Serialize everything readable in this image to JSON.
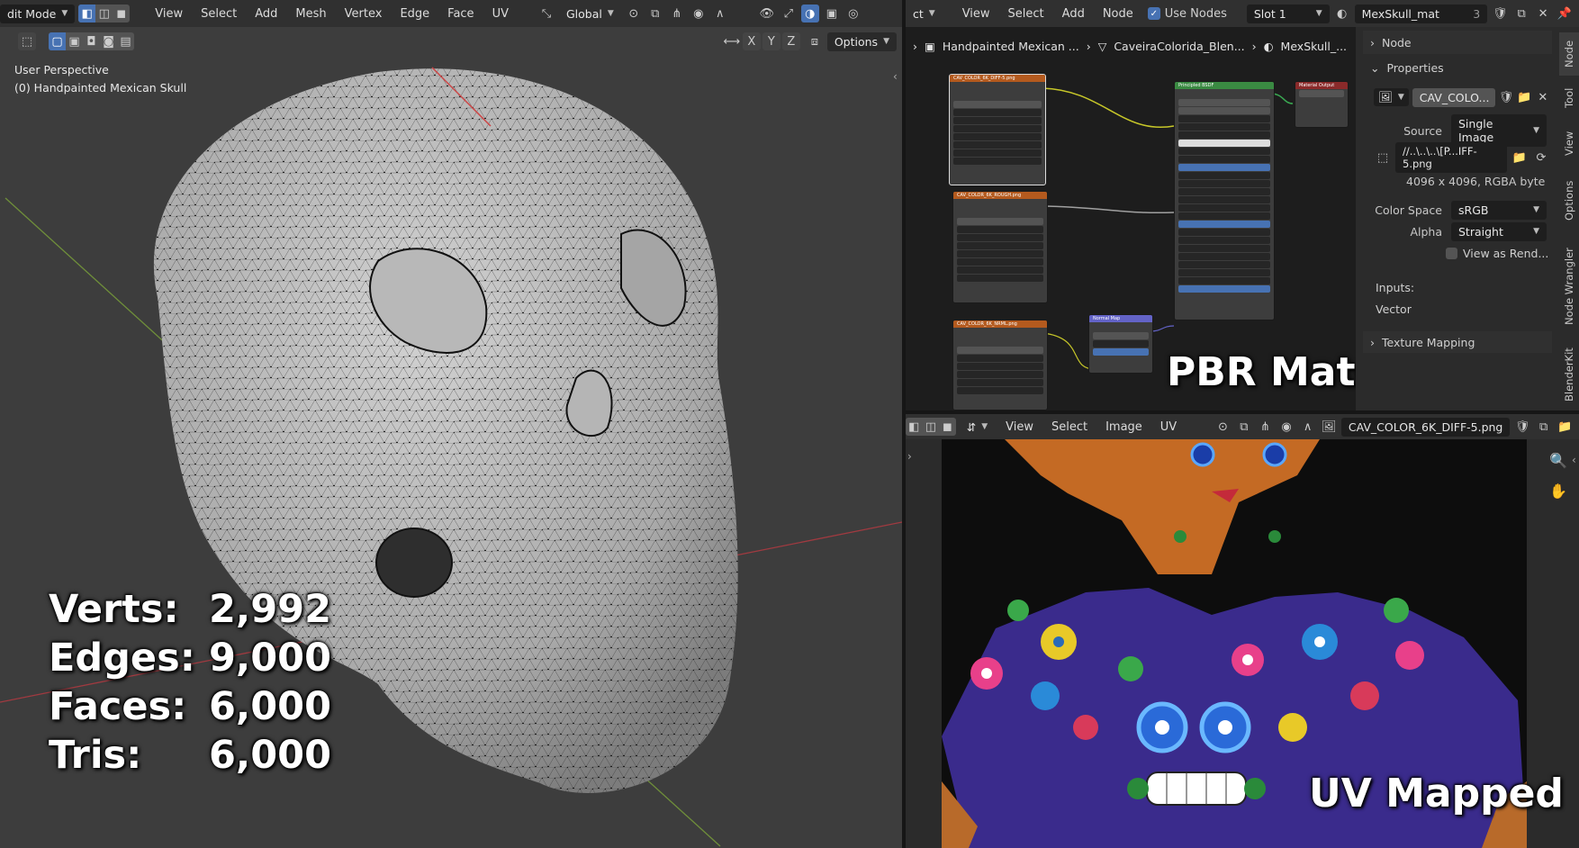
{
  "viewport": {
    "mode": "dit Mode",
    "menus": [
      "View",
      "Select",
      "Add",
      "Mesh",
      "Vertex",
      "Edge",
      "Face",
      "UV"
    ],
    "orientation": "Global",
    "axes": [
      "X",
      "Y",
      "Z"
    ],
    "options": "Options",
    "persp": "User Perspective",
    "object": "(0) Handpainted Mexican Skull",
    "stats": [
      {
        "k": "Verts:",
        "v": "2,992"
      },
      {
        "k": "Edges:",
        "v": "9,000"
      },
      {
        "k": "Faces:",
        "v": "6,000"
      },
      {
        "k": "Tris:",
        "v": "6,000"
      }
    ]
  },
  "node_editor": {
    "type": "ct",
    "menus": [
      "View",
      "Select",
      "Add",
      "Node"
    ],
    "use_nodes": "Use Nodes",
    "slot": "Slot 1",
    "material": "MexSkull_mat",
    "users": "3",
    "breadcrumb": [
      "Handpainted Mexican ...",
      "CaveiraColorida_Blen...",
      "MexSkull_..."
    ],
    "overlay": "PBR Material",
    "nodes": {
      "tex1": "CAV_COLOR_6K_DIFF-5.png",
      "tex2": "CAV_COLOR_6K_ROUGH.png",
      "tex3": "CAV_COLOR_6K_NRML.png",
      "bsdf": "Principled BSDF",
      "out": "Material Output",
      "normal": "Normal Map"
    }
  },
  "sidebar": {
    "node_panel": "Node",
    "properties_panel": "Properties",
    "image_name": "CAV_COLO...",
    "source_label": "Source",
    "source_value": "Single Image",
    "filepath": "//..\\..\\..\\[P...IFF-5.png",
    "resolution": "4096 x 4096,  RGBA byte",
    "colorspace_label": "Color Space",
    "colorspace_value": "sRGB",
    "alpha_label": "Alpha",
    "alpha_value": "Straight",
    "view_as_render": "View as Rend...",
    "inputs": "Inputs:",
    "vector": "Vector",
    "texture_mapping": "Texture Mapping",
    "tabs": [
      "Node",
      "Tool",
      "View",
      "Options",
      "Node Wrangler",
      "BlenderKit"
    ]
  },
  "uv_editor": {
    "menus": [
      "View",
      "Select",
      "Image",
      "UV"
    ],
    "image": "CAV_COLOR_6K_DIFF-5.png",
    "overlay": "UV Mapped"
  }
}
